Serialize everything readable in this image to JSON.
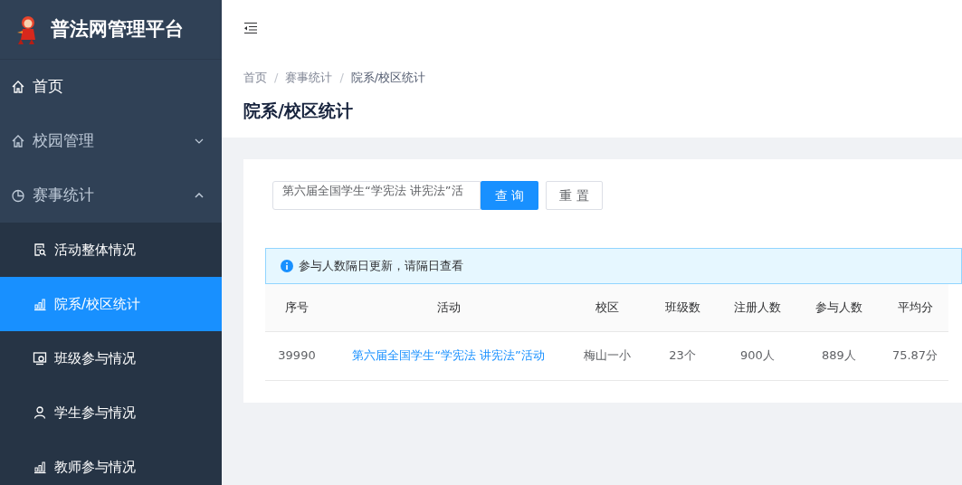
{
  "app": {
    "title": "普法网管理平台"
  },
  "sidebar": {
    "items": [
      {
        "label": "首页",
        "kind": "link"
      },
      {
        "label": "校园管理",
        "kind": "group",
        "expanded": false
      },
      {
        "label": "赛事统计",
        "kind": "group",
        "expanded": true,
        "children": [
          {
            "label": "活动整体情况",
            "selected": false
          },
          {
            "label": "院系/校区统计",
            "selected": true
          },
          {
            "label": "班级参与情况",
            "selected": false
          },
          {
            "label": "学生参与情况",
            "selected": false
          },
          {
            "label": "教师参与情况",
            "selected": false
          }
        ]
      }
    ]
  },
  "breadcrumb": [
    {
      "label": "首页"
    },
    {
      "separator": "/",
      "label": "赛事统计"
    },
    {
      "separator": "/",
      "label": "院系/校区统计"
    }
  ],
  "page_title": "院系/校区统计",
  "filter": {
    "value": "第六届全国学生“学宪法 讲宪法”活",
    "buttons": [
      {
        "label": "查 询",
        "kind": "primary"
      },
      {
        "label": "重 置",
        "kind": "default"
      }
    ]
  },
  "notice": "参与人数隔日更新，请隔日查看",
  "table": {
    "columns": [
      "序号",
      "活动",
      "校区",
      "班级数",
      "注册人数",
      "参与人数",
      "平均分"
    ],
    "rows": [
      [
        "39990",
        "第六届全国学生“学宪法 讲宪法”活动",
        "梅山一小",
        "23个",
        "900人",
        "889人",
        "75.87分"
      ]
    ]
  }
}
